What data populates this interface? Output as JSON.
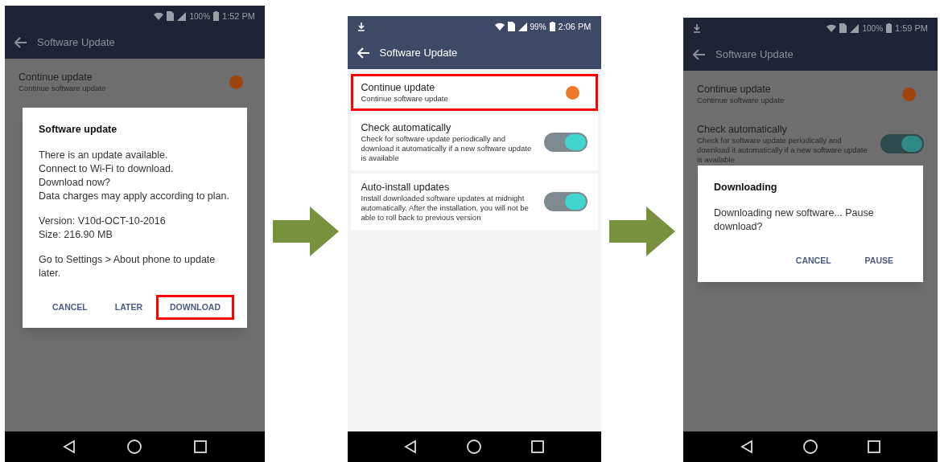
{
  "screens": [
    {
      "status": {
        "download_icon": false,
        "battery": "100%",
        "time": "1:52 PM"
      },
      "title": "Software Update",
      "dimmed": true,
      "items": [
        {
          "kind": "badge",
          "title": "Continue update",
          "subtitle": "Continue software update",
          "highlighted": false
        }
      ],
      "dialog": {
        "title": "Software update",
        "paragraphs": [
          "There is an update available.\nConnect to Wi-Fi to download.\nDownload now?\nData charges may apply according to plan.",
          "Version: V10d-OCT-10-2016\nSize: 216.90 MB",
          "Go to Settings > About phone to update later."
        ],
        "buttons": [
          {
            "label": "CANCEL",
            "highlighted": false
          },
          {
            "label": "LATER",
            "highlighted": false
          },
          {
            "label": "DOWNLOAD",
            "highlighted": true
          }
        ]
      }
    },
    {
      "status": {
        "download_icon": true,
        "battery": "99%",
        "time": "2:06 PM"
      },
      "title": "Software Update",
      "dimmed": false,
      "items": [
        {
          "kind": "badge",
          "title": "Continue update",
          "subtitle": "Continue software update",
          "highlighted": true
        },
        {
          "kind": "switch",
          "title": "Check automatically",
          "subtitle": "Check for software update periodically and download it automatically if a new software update is available",
          "on": true,
          "highlighted": false
        },
        {
          "kind": "switch",
          "title": "Auto-install updates",
          "subtitle": "Install downloaded software updates at midnight automatically. After the installation, you will not be able to roll back to previous version",
          "on": true,
          "highlighted": false
        }
      ]
    },
    {
      "status": {
        "download_icon": true,
        "battery": "100%",
        "time": "1:59 PM"
      },
      "title": "Software Update",
      "dimmed": true,
      "items": [
        {
          "kind": "badge",
          "title": "Continue update",
          "subtitle": "Continue software update",
          "highlighted": false
        },
        {
          "kind": "switch",
          "title": "Check automatically",
          "subtitle": "Check for software update periodically and download it automatically if a new software update is available",
          "on": true,
          "highlighted": false
        }
      ],
      "dialog": {
        "title": "Downloading",
        "paragraphs": [
          "Downloading new software... Pause download?"
        ],
        "buttons": [
          {
            "label": "CANCEL",
            "highlighted": false
          },
          {
            "label": "PAUSE",
            "highlighted": false
          }
        ]
      }
    }
  ]
}
